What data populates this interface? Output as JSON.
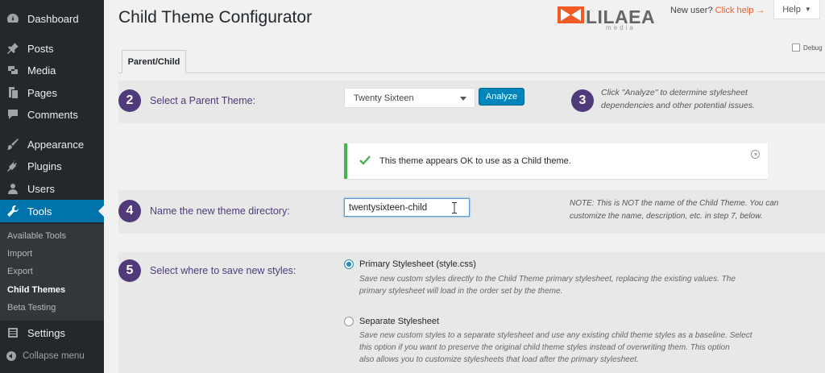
{
  "sidebar": {
    "items": [
      {
        "label": "Dashboard",
        "icon": "dashboard-icon"
      },
      {
        "label": "Posts",
        "icon": "pin-icon"
      },
      {
        "label": "Media",
        "icon": "media-icon"
      },
      {
        "label": "Pages",
        "icon": "pages-icon"
      },
      {
        "label": "Comments",
        "icon": "comment-icon"
      },
      {
        "label": "Appearance",
        "icon": "brush-icon"
      },
      {
        "label": "Plugins",
        "icon": "plugin-icon"
      },
      {
        "label": "Users",
        "icon": "users-icon"
      },
      {
        "label": "Tools",
        "icon": "wrench-icon",
        "active": true
      },
      {
        "label": "Settings",
        "icon": "settings-icon"
      }
    ],
    "submenu": [
      "Available Tools",
      "Import",
      "Export",
      "Child Themes",
      "Beta Testing"
    ],
    "current_submenu": "Child Themes",
    "collapse_label": "Collapse menu"
  },
  "header": {
    "title": "Child Theme Configurator",
    "logo_word": "LILAEA",
    "logo_sub": "media",
    "new_user_text": "New user?",
    "help_link": "Click help →",
    "help_tab": "Help",
    "debug_label": "Debug"
  },
  "tabs": [
    {
      "label": "Parent/Child"
    }
  ],
  "step2": {
    "number": "2",
    "label": "Select a Parent Theme:",
    "selected_theme": "Twenty Sixteen",
    "analyze_button": "Analyze"
  },
  "step3": {
    "number": "3",
    "note": "Click \"Analyze\" to determine stylesheet dependencies and other potential issues."
  },
  "notice": {
    "message": "This theme appears OK to use as a Child theme."
  },
  "step4": {
    "number": "4",
    "label": "Name the new theme directory:",
    "value": "twentysixteen-child",
    "note_line1": "NOTE: This is NOT the name of the Child Theme. You can",
    "note_line2": "customize the name, description, etc. in step 7, below."
  },
  "step5": {
    "number": "5",
    "label": "Select where to save new styles:",
    "options": [
      {
        "title": "Primary Stylesheet (style.css)",
        "checked": true,
        "desc_lines": [
          "Save new custom styles directly to the Child Theme primary stylesheet, replacing the existing values. The",
          "primary stylesheet will load in the order set by the theme."
        ]
      },
      {
        "title": "Separate Stylesheet",
        "checked": false,
        "desc_lines": [
          "Save new custom styles to a separate stylesheet and use any existing child theme styles as a baseline. Select",
          "this option if you want to preserve the original child theme styles instead of overwriting them. This option",
          "also allows you to customize stylesheets that load after the primary stylesheet."
        ]
      }
    ]
  },
  "colors": {
    "sidebar_bg": "#23282d",
    "active_blue": "#0073aa",
    "step_purple": "#4f3a7a",
    "success_green": "#46b450",
    "brand_orange": "#f25a26"
  }
}
